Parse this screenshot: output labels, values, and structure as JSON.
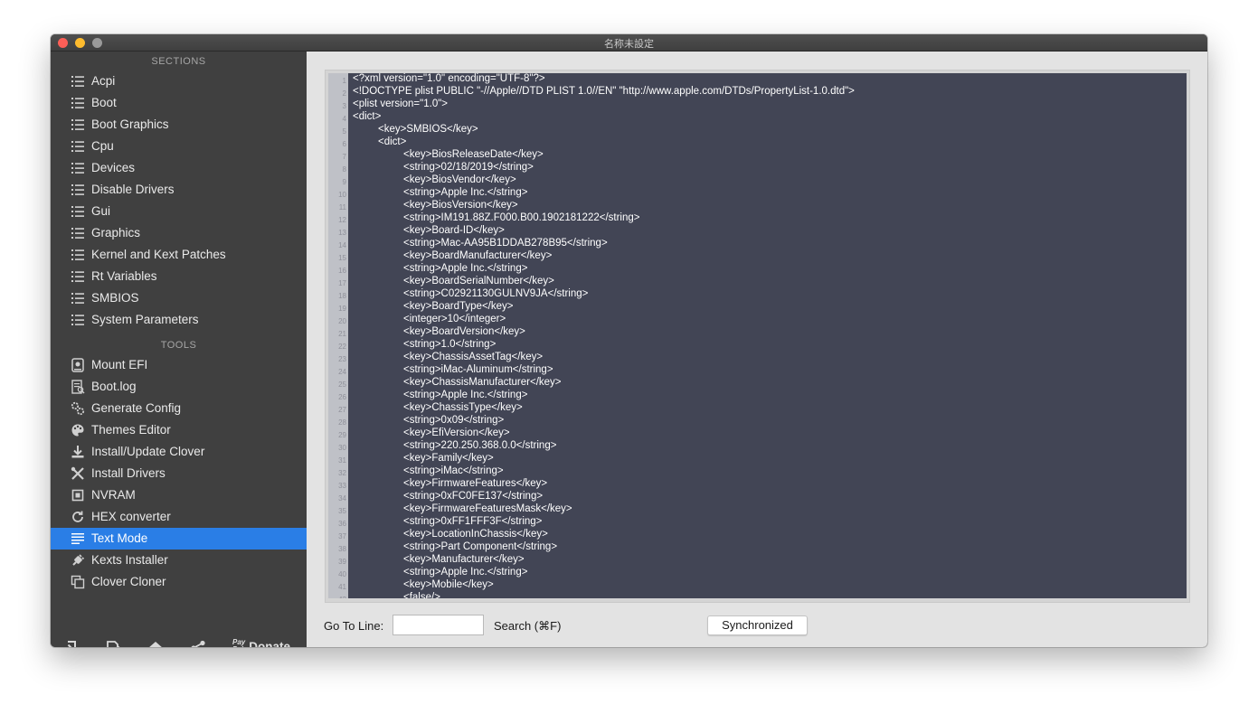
{
  "window": {
    "title": "名称未設定"
  },
  "sidebar": {
    "sections_header": "SECTIONS",
    "sections": [
      {
        "label": "Acpi",
        "icon": "list-icon"
      },
      {
        "label": "Boot",
        "icon": "list-icon"
      },
      {
        "label": "Boot Graphics",
        "icon": "list-icon"
      },
      {
        "label": "Cpu",
        "icon": "list-icon"
      },
      {
        "label": "Devices",
        "icon": "list-icon"
      },
      {
        "label": "Disable Drivers",
        "icon": "list-icon"
      },
      {
        "label": "Gui",
        "icon": "list-icon"
      },
      {
        "label": "Graphics",
        "icon": "list-icon"
      },
      {
        "label": "Kernel and Kext Patches",
        "icon": "list-icon"
      },
      {
        "label": "Rt Variables",
        "icon": "list-icon"
      },
      {
        "label": "SMBIOS",
        "icon": "list-icon"
      },
      {
        "label": "System Parameters",
        "icon": "list-icon"
      }
    ],
    "tools_header": "TOOLS",
    "tools": [
      {
        "label": "Mount EFI",
        "icon": "disk-icon"
      },
      {
        "label": "Boot.log",
        "icon": "log-icon"
      },
      {
        "label": "Generate Config",
        "icon": "gears-icon"
      },
      {
        "label": "Themes Editor",
        "icon": "palette-icon"
      },
      {
        "label": "Install/Update Clover",
        "icon": "download-icon"
      },
      {
        "label": "Install Drivers",
        "icon": "wrench-icon"
      },
      {
        "label": "NVRAM",
        "icon": "chip-icon"
      },
      {
        "label": "HEX converter",
        "icon": "refresh-icon"
      },
      {
        "label": "Text Mode",
        "icon": "text-icon",
        "selected": true
      },
      {
        "label": "Kexts Installer",
        "icon": "plug-icon"
      },
      {
        "label": "Clover Cloner",
        "icon": "copy-icon"
      }
    ],
    "bottom": {
      "icons": [
        "import-icon",
        "export-icon",
        "home-icon",
        "share-icon"
      ],
      "paypal_top": "Pay",
      "paypal_bottom": "Pal",
      "donate_label": "Donate"
    }
  },
  "editor": {
    "lines": [
      "<?xml version=\"1.0\" encoding=\"UTF-8\"?>",
      "<!DOCTYPE plist PUBLIC \"-//Apple//DTD PLIST 1.0//EN\" \"http://www.apple.com/DTDs/PropertyList-1.0.dtd\">",
      "<plist version=\"1.0\">",
      "<dict>",
      "\t<key>SMBIOS</key>",
      "\t<dict>",
      "\t\t<key>BiosReleaseDate</key>",
      "\t\t<string>02/18/2019</string>",
      "\t\t<key>BiosVendor</key>",
      "\t\t<string>Apple Inc.</string>",
      "\t\t<key>BiosVersion</key>",
      "\t\t<string>IM191.88Z.F000.B00.1902181222</string>",
      "\t\t<key>Board-ID</key>",
      "\t\t<string>Mac-AA95B1DDAB278B95</string>",
      "\t\t<key>BoardManufacturer</key>",
      "\t\t<string>Apple Inc.</string>",
      "\t\t<key>BoardSerialNumber</key>",
      "\t\t<string>C02921130GULNV9JA</string>",
      "\t\t<key>BoardType</key>",
      "\t\t<integer>10</integer>",
      "\t\t<key>BoardVersion</key>",
      "\t\t<string>1.0</string>",
      "\t\t<key>ChassisAssetTag</key>",
      "\t\t<string>iMac-Aluminum</string>",
      "\t\t<key>ChassisManufacturer</key>",
      "\t\t<string>Apple Inc.</string>",
      "\t\t<key>ChassisType</key>",
      "\t\t<string>0x09</string>",
      "\t\t<key>EfiVersion</key>",
      "\t\t<string>220.250.368.0.0</string>",
      "\t\t<key>Family</key>",
      "\t\t<string>iMac</string>",
      "\t\t<key>FirmwareFeatures</key>",
      "\t\t<string>0xFC0FE137</string>",
      "\t\t<key>FirmwareFeaturesMask</key>",
      "\t\t<string>0xFF1FFF3F</string>",
      "\t\t<key>LocationInChassis</key>",
      "\t\t<string>Part Component</string>",
      "\t\t<key>Manufacturer</key>",
      "\t\t<string>Apple Inc.</string>",
      "\t\t<key>Mobile</key>",
      "\t\t<false/>"
    ]
  },
  "footer": {
    "goto_label": "Go To Line:",
    "goto_value": "",
    "search_label": "Search (⌘F)",
    "sync_label": "Synchronized"
  },
  "colors": {
    "sidebar_bg": "#404040",
    "selection": "#2a7ee6",
    "editor_bg": "#424555",
    "editor_text": "#ffffff",
    "main_bg": "#e3e3e3"
  }
}
